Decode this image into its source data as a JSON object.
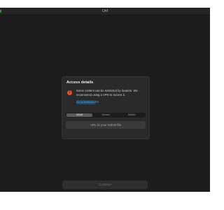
{
  "window": {
    "title": "Unf"
  },
  "dialog": {
    "title": "Access details",
    "warning_text": "Some content can be restricted by location. We recommend using a VPN to access it.",
    "vpn_button_label": "Set up Surfshark VPN",
    "tabs": [
      {
        "label": "M3U8",
        "active": true
      },
      {
        "label": "Xtream",
        "active": false
      },
      {
        "label": "Stalker",
        "active": false
      }
    ],
    "url_placeholder": "URL to your M3U8 file"
  },
  "footer": {
    "continue_label": "Continue"
  },
  "colors": {
    "warning": "#d9542b",
    "vpn_button_bg": "#234a6c",
    "vpn_button_text": "#5da0d6"
  },
  "icons": {
    "warning": "exclamation-circle-icon"
  }
}
